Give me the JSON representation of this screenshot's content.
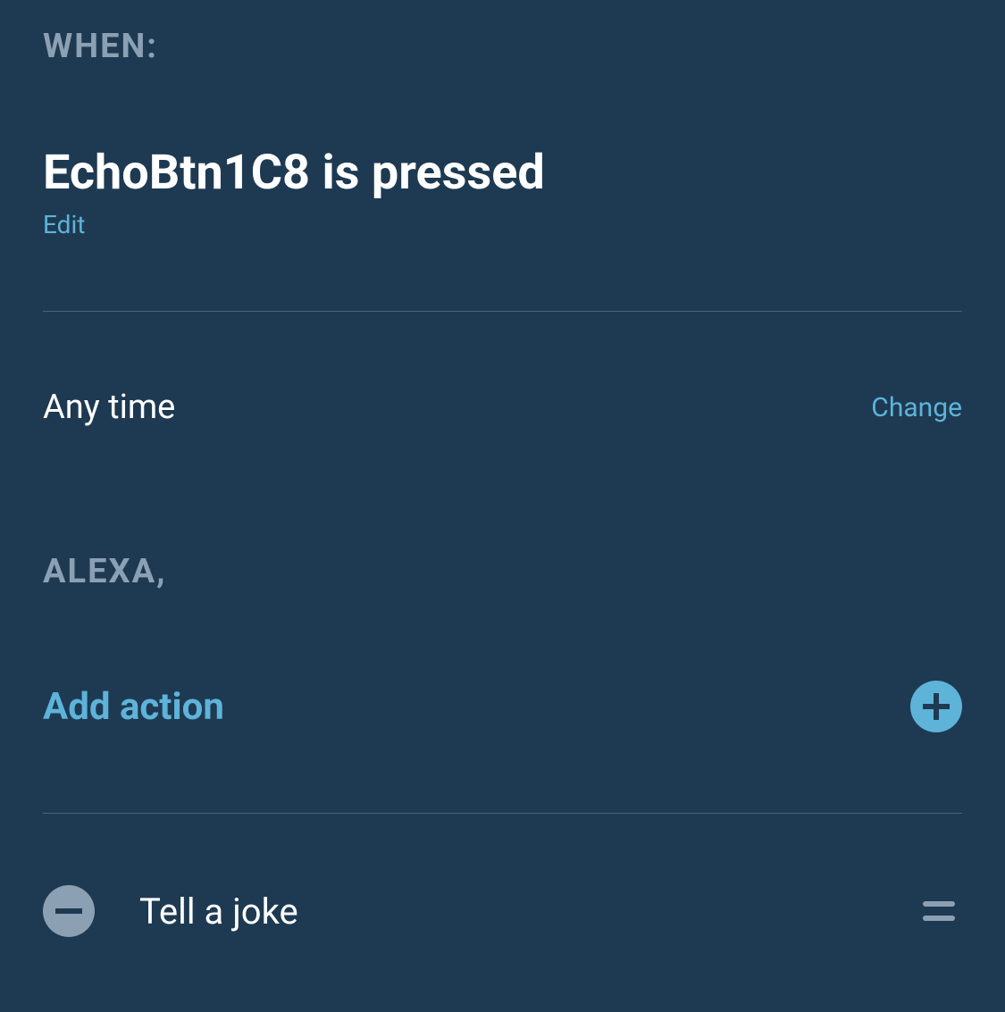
{
  "when": {
    "header": "WHEN:",
    "trigger_title": "EchoBtn1C8 is pressed",
    "edit_label": "Edit"
  },
  "time": {
    "label": "Any time",
    "change_label": "Change"
  },
  "alexa": {
    "header": "ALEXA,",
    "add_action_label": "Add action"
  },
  "actions": [
    {
      "label": "Tell a joke"
    }
  ]
}
